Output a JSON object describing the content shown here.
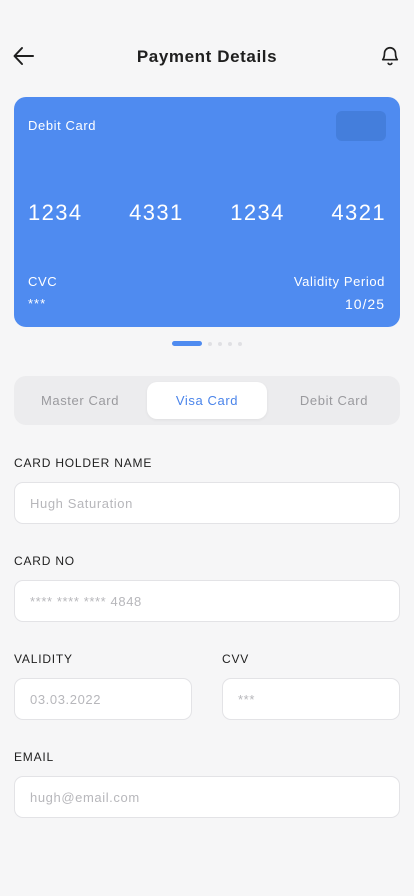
{
  "header": {
    "title": "Payment Details"
  },
  "card": {
    "type": "Debit Card",
    "numbers": [
      "1234",
      "4331",
      "1234",
      "4321"
    ],
    "cvc_label": "CVC",
    "cvc_value": "***",
    "validity_label": "Validity Period",
    "validity_value": "10/25",
    "color": "#4f8bf0"
  },
  "carousel": {
    "page_count": 5,
    "active_index": 0
  },
  "tabs": {
    "items": [
      {
        "label": "Master Card"
      },
      {
        "label": "Visa Card"
      },
      {
        "label": "Debit Card"
      }
    ],
    "selected": "Visa Card"
  },
  "form": {
    "holder_name": {
      "label": "CARD HOLDER NAME",
      "placeholder": "Hugh Saturation"
    },
    "card_no": {
      "label": "CARD NO",
      "placeholder": "**** **** **** 4848"
    },
    "validity": {
      "label": "VALIDITY",
      "placeholder": "03.03.2022"
    },
    "cvv": {
      "label": "CVV",
      "placeholder": "***"
    },
    "email": {
      "label": "EMAIL",
      "placeholder": "hugh@email.com"
    }
  },
  "icons": {
    "back": "arrow-left-icon",
    "notifications": "bell-icon"
  },
  "colors": {
    "accent": "#4f8bf0",
    "background": "#f6f6f7"
  }
}
